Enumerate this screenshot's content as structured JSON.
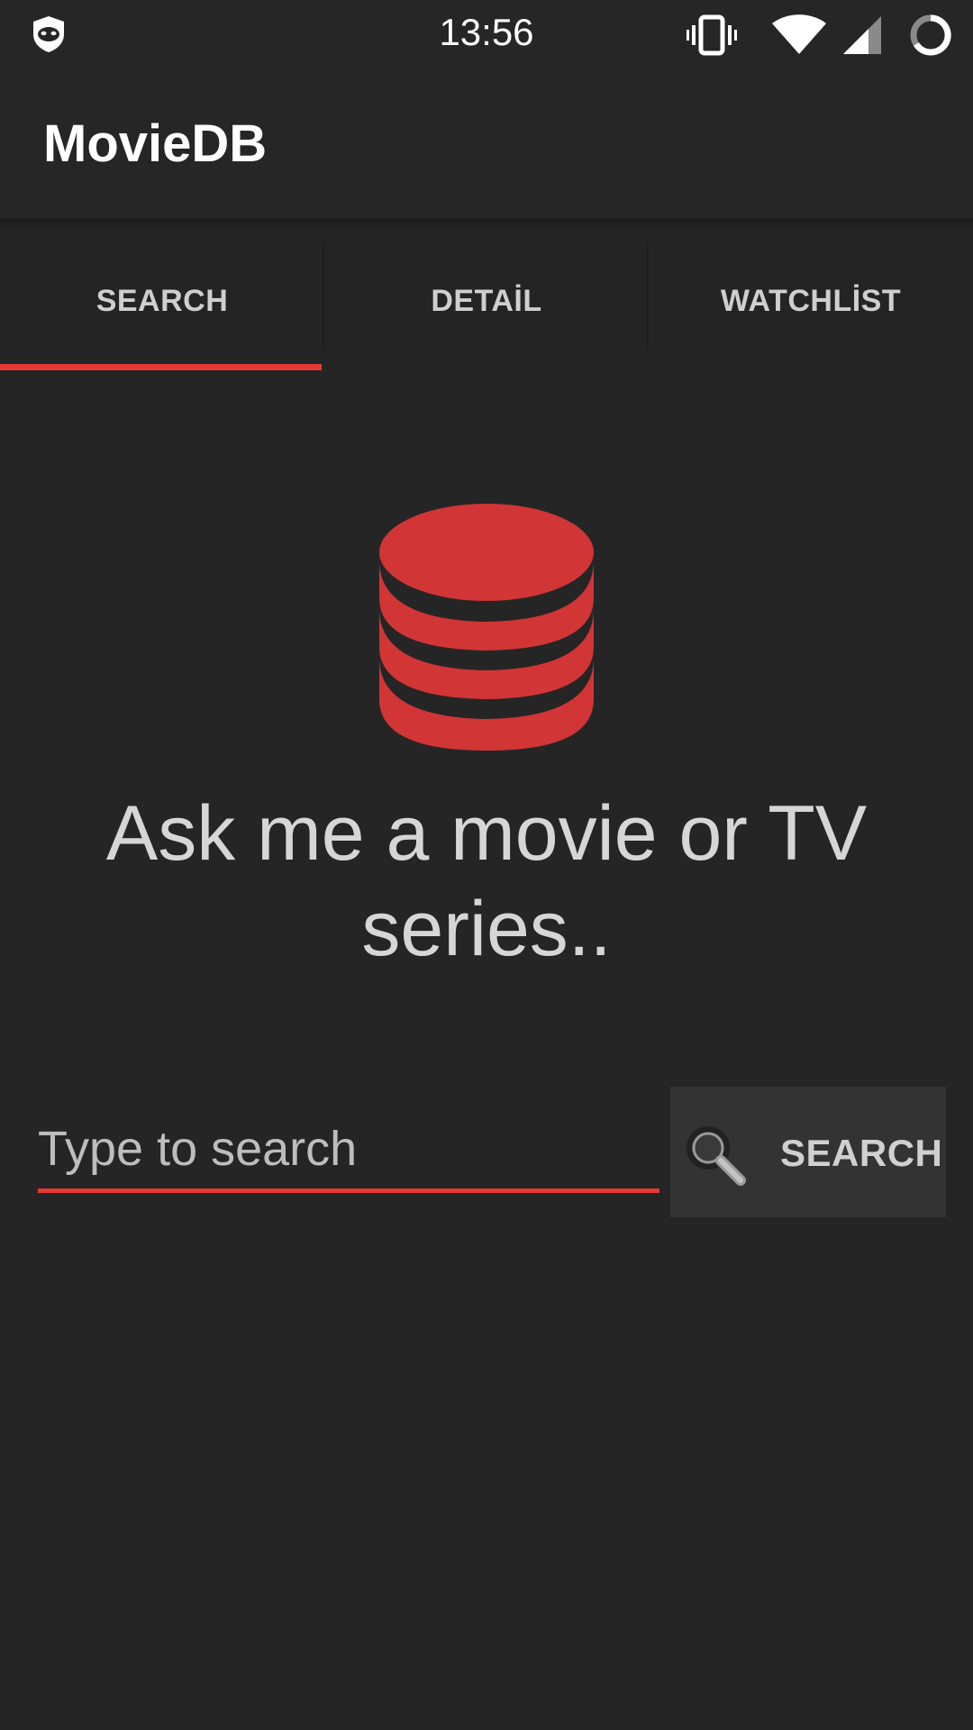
{
  "status_bar": {
    "time": "13:56",
    "icons": [
      "hood-mask-icon",
      "vibrate-icon",
      "wifi-icon",
      "cell-signal-icon",
      "sync-ring-icon"
    ]
  },
  "app_bar": {
    "title": "MovieDB"
  },
  "tabs": [
    {
      "label": "SEARCH",
      "selected": true
    },
    {
      "label": "DETAİL",
      "selected": false
    },
    {
      "label": "WATCHLİST",
      "selected": false
    }
  ],
  "main": {
    "icon": "database-icon",
    "headline": "Ask me a movie or TV series..",
    "search": {
      "placeholder": "Type to search",
      "value": "",
      "button_label": "SEARCH",
      "button_icon": "search-icon"
    }
  },
  "colors": {
    "background": "#252525",
    "accent": "#e53935",
    "icon_red": "#d23535"
  }
}
